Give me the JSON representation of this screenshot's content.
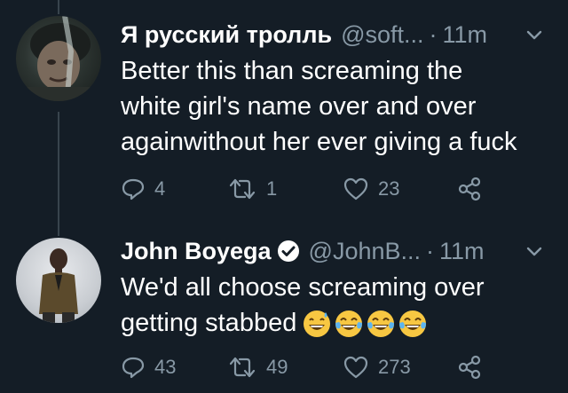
{
  "tweets": [
    {
      "name": "Я русский тролль",
      "handle": "@soft...",
      "time": "11m",
      "text": "Better this than screaming the\nwhite girl's name over and over\nagainwithout her ever giving a fuck",
      "verified": false,
      "replies": "4",
      "retweets": "1",
      "likes": "23"
    },
    {
      "name": "John Boyega",
      "handle": "@JohnB...",
      "time": "11m",
      "text": "We'd all choose screaming over\ngetting stabbed",
      "verified": true,
      "emojis": [
        "grinning-sweat-emoji",
        "tears-of-joy-emoji",
        "tears-of-joy-emoji",
        "tears-of-joy-emoji"
      ],
      "replies": "43",
      "retweets": "49",
      "likes": "273"
    }
  ],
  "colors": {
    "background": "#141d26",
    "secondary_text": "#8899a6",
    "verified": "#1da1f2"
  }
}
